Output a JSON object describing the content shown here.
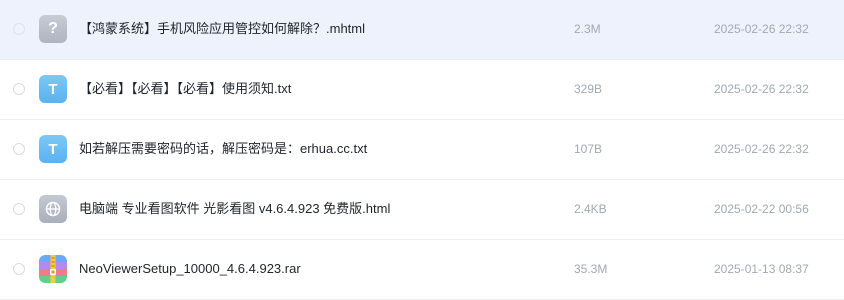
{
  "files": [
    {
      "name": "【鸿蒙系统】手机风险应用管控如何解除？.mhtml",
      "size": "2.3M",
      "date": "2025-02-26 22:32",
      "icon": "unknown-file-icon",
      "icon_glyph": "?",
      "selected": true
    },
    {
      "name": "【必看】【必看】【必看】使用须知.txt",
      "size": "329B",
      "date": "2025-02-26 22:32",
      "icon": "txt-file-icon",
      "icon_glyph": "T",
      "selected": false
    },
    {
      "name": "如若解压需要密码的话，解压密码是：erhua.cc.txt",
      "size": "107B",
      "date": "2025-02-26 22:32",
      "icon": "txt-file-icon",
      "icon_glyph": "T",
      "selected": false
    },
    {
      "name": "电脑端 专业看图软件 光影看图 v4.6.4.923 免费版.html",
      "size": "2.4KB",
      "date": "2025-02-22 00:56",
      "icon": "web-file-icon",
      "icon_glyph": "",
      "selected": false
    },
    {
      "name": "NeoViewerSetup_10000_4.6.4.923.rar",
      "size": "35.3M",
      "date": "2025-01-13 08:37",
      "icon": "archive-file-icon",
      "icon_glyph": "",
      "selected": false
    }
  ],
  "colors": {
    "selected_row_bg": "#eef2fd",
    "txt_icon": "#5ab2ef",
    "unknown_icon": "#aeb4c0",
    "meta_text": "#a3a8b2"
  }
}
